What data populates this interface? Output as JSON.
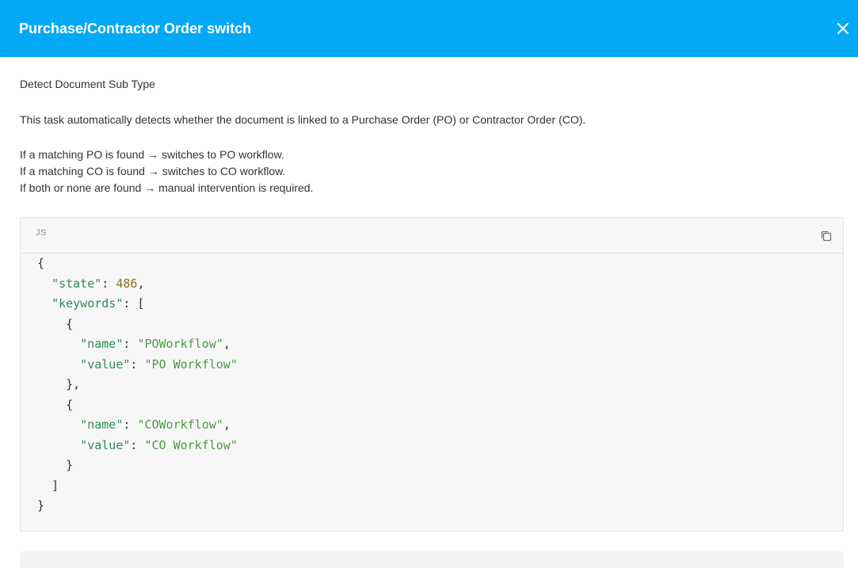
{
  "dialog": {
    "title": "Purchase/Contractor Order switch"
  },
  "body": {
    "subtitle": "Detect Document Sub Type",
    "description": "This task automatically detects whether the document is linked to a Purchase Order (PO) or Contractor Order (CO).",
    "rules": [
      "If a matching PO is found → switches to PO workflow.",
      "If a matching CO is found → switches to CO workflow.",
      "If both or none are found → manual intervention is required."
    ]
  },
  "code": {
    "language": "JS",
    "state_key": "\"state\"",
    "state_value": "486",
    "keywords_key": "\"keywords\"",
    "items": [
      {
        "name_key": "\"name\"",
        "name_value": "\"POWorkflow\"",
        "value_key": "\"value\"",
        "value_value": "\"PO Workflow\""
      },
      {
        "name_key": "\"name\"",
        "name_value": "\"COWorkflow\"",
        "value_key": "\"value\"",
        "value_value": "\"CO Workflow\""
      }
    ]
  },
  "icons": {
    "close": "close-icon",
    "copy": "copy-icon"
  },
  "colors": {
    "header_bg": "#03a9f4",
    "code_key": "#2e8b57",
    "code_string": "#4a9c40",
    "code_number": "#8a6d1a"
  }
}
